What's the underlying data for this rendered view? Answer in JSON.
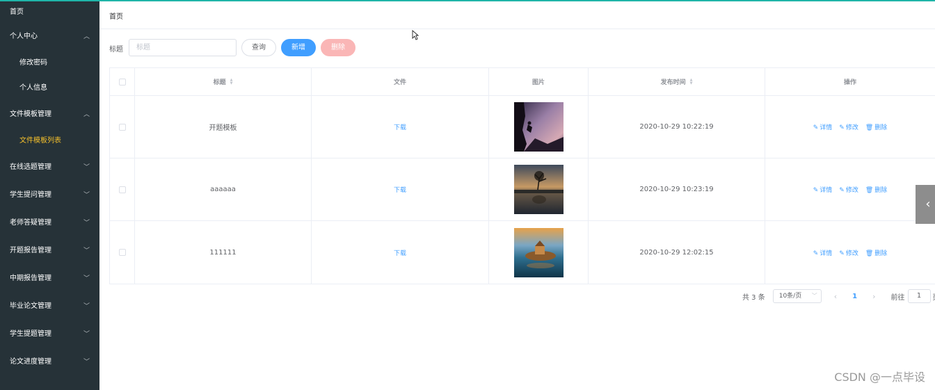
{
  "sidebar": {
    "home": "首页",
    "groups": [
      {
        "label": "个人中心",
        "expanded": true,
        "children": [
          "修改密码",
          "个人信息"
        ]
      },
      {
        "label": "文件模板管理",
        "expanded": true,
        "children": [
          "文件模板列表"
        ],
        "active_child": "文件模板列表"
      },
      {
        "label": "在线选题管理",
        "expanded": false
      },
      {
        "label": "学生提问管理",
        "expanded": false
      },
      {
        "label": "老师答疑管理",
        "expanded": false
      },
      {
        "label": "开题报告管理",
        "expanded": false
      },
      {
        "label": "中期报告管理",
        "expanded": false
      },
      {
        "label": "毕业论文管理",
        "expanded": false
      },
      {
        "label": "学生提题管理",
        "expanded": false
      },
      {
        "label": "论文进度管理",
        "expanded": false
      }
    ],
    "bg_color": "#263238",
    "active_color": "#f5c02b"
  },
  "breadcrumb": "首页",
  "search": {
    "label": "标题",
    "placeholder": "标题",
    "value": ""
  },
  "buttons": {
    "query": "查询",
    "add": "新增",
    "delete": "删除"
  },
  "table": {
    "columns": [
      "标题",
      "文件",
      "图片",
      "发布时间",
      "操作"
    ],
    "rows": [
      {
        "title": "开题模板",
        "file": "下载",
        "image_icon": "climber-silhouette-photo",
        "time": "2020-10-29 10:22:19"
      },
      {
        "title": "aaaaaa",
        "file": "下载",
        "image_icon": "lake-tree-sunset-photo",
        "time": "2020-10-29 10:23:19"
      },
      {
        "title": "111111",
        "file": "下载",
        "image_icon": "island-castle-photo",
        "time": "2020-10-29 12:02:15"
      }
    ],
    "actions": {
      "detail": "详情",
      "edit": "修改",
      "delete": "删除"
    }
  },
  "pagination": {
    "total": "共 3 条",
    "page_size": "10条/页",
    "current_page": "1",
    "goto_label": "前往",
    "goto_value": "1",
    "goto_suffix": "页"
  },
  "watermark": "CSDN @一点毕设",
  "colors": {
    "primary": "#409eff",
    "danger_light": "#fab6b6",
    "accent_top": "#1fb5a8"
  }
}
